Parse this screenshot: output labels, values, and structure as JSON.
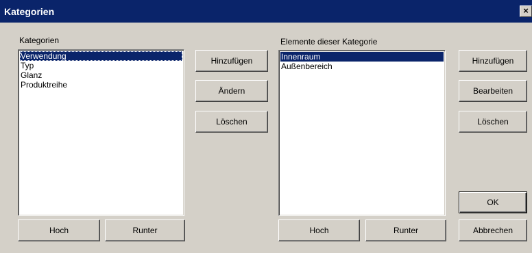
{
  "window": {
    "title": "Kategorien",
    "close_glyph": "×"
  },
  "categories": {
    "label": "Kategorien",
    "items": [
      "Verwendung",
      "Typ",
      "Glanz",
      "Produktreihe"
    ],
    "selected_index": 0
  },
  "middle_buttons": {
    "add": {
      "pre": "H",
      "key": "i",
      "post": "nzufügen"
    },
    "change": {
      "pre": "",
      "key": "Ä",
      "post": "ndern"
    },
    "delete": {
      "pre": "",
      "key": "L",
      "post": "öschen"
    }
  },
  "left_bottom_buttons": {
    "up": {
      "pre": "",
      "key": "H",
      "post": "och"
    },
    "down": {
      "pre": "",
      "key": "R",
      "post": "unter"
    }
  },
  "elements": {
    "label": "Elemente dieser Kategorie",
    "items": [
      "Innenraum",
      "Außenbereich"
    ],
    "selected_index": 0
  },
  "right_bottom_buttons": {
    "up": {
      "pre": "H",
      "key": "o",
      "post": "ch"
    },
    "down": {
      "pre": "R",
      "key": "u",
      "post": "nter"
    }
  },
  "right_buttons": {
    "add": {
      "pre": "Hin",
      "key": "z",
      "post": "ufügen"
    },
    "edit": {
      "pre": "",
      "key": "B",
      "post": "earbeiten"
    },
    "delete": {
      "pre": "",
      "key": "L",
      "post": "öschen"
    },
    "ok": "OK",
    "cancel": "Abbrechen"
  }
}
